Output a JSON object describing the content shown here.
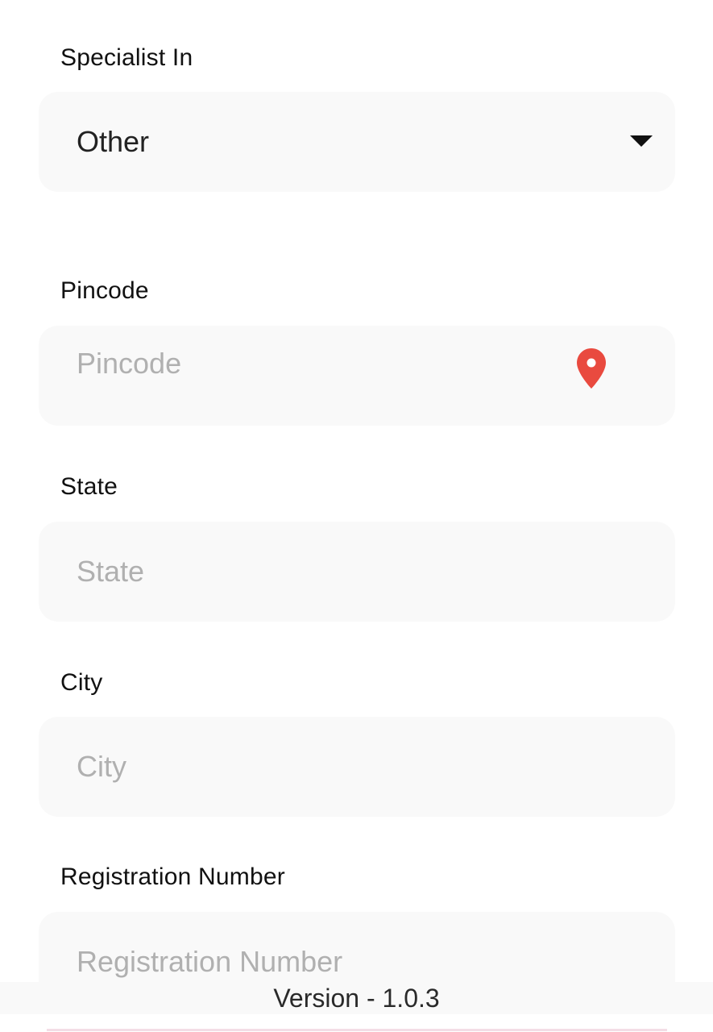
{
  "form": {
    "specialist": {
      "label": "Specialist In",
      "selected": "Other"
    },
    "pincode": {
      "label": "Pincode",
      "placeholder": "Pincode",
      "icon": "location-pin-icon",
      "icon_color": "#e94a3f"
    },
    "state": {
      "label": "State",
      "placeholder": "State"
    },
    "city": {
      "label": "City",
      "placeholder": "City"
    },
    "registration": {
      "label": "Registration Number",
      "placeholder": "Registration Number"
    }
  },
  "footer": {
    "version": "Version - 1.0.3"
  }
}
